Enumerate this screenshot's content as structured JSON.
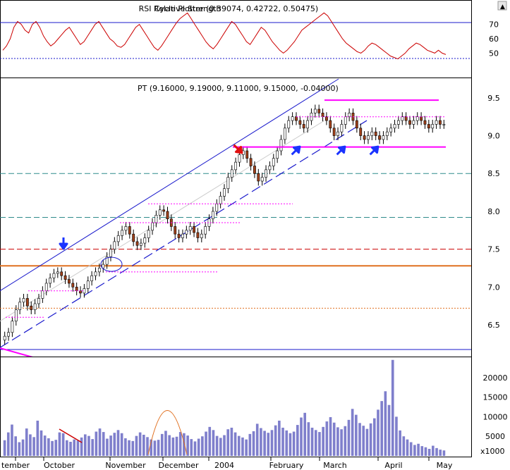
{
  "chart_data": {
    "type": "candlestick",
    "title": "",
    "rsi_panel": {
      "label": "Cycle Plotter (0.39074, 0.42722, 0.50475)",
      "overlay_label": "RSI Relative Strength",
      "yticks": [
        70,
        60,
        50
      ],
      "ylim": [
        35,
        85
      ],
      "levels": [
        70,
        50
      ],
      "series": [
        52,
        55,
        60,
        68,
        72,
        70,
        66,
        64,
        70,
        72,
        68,
        62,
        58,
        55,
        57,
        60,
        63,
        66,
        68,
        64,
        60,
        56,
        58,
        62,
        66,
        70,
        72,
        68,
        64,
        60,
        58,
        55,
        54,
        56,
        60,
        64,
        68,
        70,
        66,
        62,
        58,
        54,
        52,
        55,
        59,
        63,
        67,
        71,
        74,
        76,
        78,
        74,
        70,
        66,
        62,
        58,
        55,
        53,
        56,
        60,
        64,
        68,
        72,
        70,
        66,
        62,
        58,
        56,
        60,
        64,
        68,
        66,
        62,
        58,
        55,
        52,
        50,
        52,
        55,
        58,
        62,
        66,
        68,
        70,
        72,
        74,
        76,
        78,
        76,
        72,
        68,
        64,
        60,
        57,
        55,
        53,
        51,
        50,
        52,
        55,
        57,
        56,
        54,
        52,
        50,
        48,
        47,
        46,
        48,
        50,
        53,
        55,
        57,
        56,
        54,
        52,
        51,
        50,
        52,
        50,
        49
      ]
    },
    "price_panel": {
      "label": "PT (9.16000, 9.19000, 9.11000, 9.15000, -0.04000)",
      "yticks": [
        9.5,
        9.0,
        8.5,
        8.0,
        7.5,
        7.0,
        6.5
      ],
      "ylim": [
        6.1,
        9.75
      ],
      "closes": [
        6.35,
        6.4,
        6.55,
        6.7,
        6.8,
        6.85,
        6.75,
        6.7,
        6.78,
        6.85,
        6.95,
        7.05,
        7.12,
        7.18,
        7.2,
        7.15,
        7.1,
        7.05,
        7.0,
        6.95,
        6.92,
        6.98,
        7.08,
        7.15,
        7.2,
        7.25,
        7.3,
        7.4,
        7.5,
        7.6,
        7.68,
        7.75,
        7.8,
        7.7,
        7.6,
        7.55,
        7.58,
        7.65,
        7.75,
        7.85,
        7.95,
        8.02,
        8.0,
        7.9,
        7.8,
        7.7,
        7.65,
        7.7,
        7.75,
        7.8,
        7.72,
        7.65,
        7.7,
        7.8,
        7.9,
        8.0,
        8.1,
        8.2,
        8.3,
        8.45,
        8.55,
        8.65,
        8.75,
        8.8,
        8.7,
        8.6,
        8.5,
        8.4,
        8.45,
        8.55,
        8.6,
        8.7,
        8.8,
        8.95,
        9.1,
        9.2,
        9.25,
        9.2,
        9.15,
        9.1,
        9.2,
        9.3,
        9.35,
        9.3,
        9.25,
        9.2,
        9.1,
        9.0,
        9.05,
        9.15,
        9.25,
        9.3,
        9.2,
        9.1,
        9.0,
        8.95,
        9.0,
        9.05,
        9.0,
        8.95,
        9.0,
        9.05,
        9.1,
        9.15,
        9.2,
        9.25,
        9.2,
        9.15,
        9.2,
        9.25,
        9.2,
        9.15,
        9.1,
        9.15,
        9.2,
        9.15,
        9.15
      ]
    },
    "volume_panel": {
      "yticks": [
        20000,
        15000,
        10000,
        5000
      ],
      "unit_label": "x1000",
      "ylim": [
        0,
        25000
      ],
      "values": [
        4000,
        6000,
        8000,
        5000,
        3500,
        4200,
        7000,
        5500,
        4800,
        9000,
        6500,
        5200,
        4500,
        3800,
        4100,
        6000,
        5800,
        4000,
        3600,
        4200,
        3900,
        4700,
        5500,
        5100,
        4300,
        6200,
        7000,
        6100,
        4400,
        5200,
        5900,
        6600,
        5800,
        4500,
        4000,
        3800,
        5100,
        6000,
        5400,
        4800,
        4200,
        3900,
        4100,
        5600,
        6400,
        5300,
        4700,
        4900,
        6100,
        5800,
        5200,
        4300,
        3700,
        4400,
        5000,
        6200,
        7400,
        6600,
        5100,
        4600,
        5300,
        6800,
        7200,
        6000,
        5100,
        4700,
        4200,
        5600,
        6300,
        8200,
        7100,
        6400,
        5900,
        6600,
        7800,
        9000,
        7200,
        6500,
        5800,
        6200,
        7900,
        9800,
        11000,
        8600,
        7200,
        6600,
        6100,
        7400,
        8800,
        9900,
        8500,
        7300,
        6800,
        7600,
        9200,
        12000,
        10500,
        8400,
        7700,
        6900,
        8300,
        9600,
        11800,
        14000,
        16500,
        13000,
        24500,
        10000,
        6500,
        5000,
        4200,
        3500,
        2800,
        3100,
        2500,
        2200,
        1800,
        2600,
        2000,
        1600,
        1400
      ],
      "color": "#7f7fcc"
    },
    "x_tick_labels": [
      "tember",
      "October",
      "November",
      "December",
      "2004",
      "February",
      "March",
      "April",
      "May"
    ],
    "candle_up_color": "#ffffff",
    "candle_down_color": "#a0401a",
    "channel_color": "#1a1acc",
    "resistance_color": "#ff00ff",
    "arrow_color": "#1a33ff",
    "horizontal_levels": [
      {
        "value": 8.5,
        "color": "#2e8b8b",
        "style": "dashed"
      },
      {
        "value": 7.92,
        "color": "#2e8b8b",
        "style": "dashed"
      },
      {
        "value": 7.5,
        "color": "#cc0000",
        "style": "dashed"
      },
      {
        "value": 7.28,
        "color": "#e07020",
        "style": "solid"
      },
      {
        "value": 6.72,
        "color": "#e07020",
        "style": "dotted"
      }
    ]
  }
}
